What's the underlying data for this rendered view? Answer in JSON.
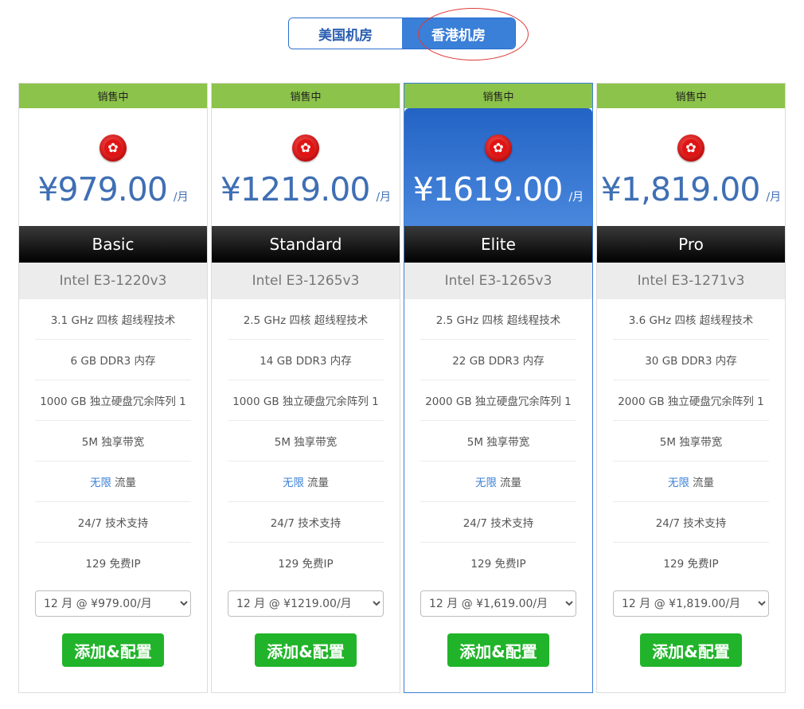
{
  "toggle": {
    "us": "美国机房",
    "hk": "香港机房"
  },
  "plans": [
    {
      "status": "销售中",
      "price": "¥979.00",
      "period": "/月",
      "name": "Basic",
      "cpu": "Intel E3-1220v3",
      "features": {
        "clock": "3.1 GHz 四核 超线程技术",
        "ram": "6 GB DDR3 内存",
        "disk": "1000 GB 独立硬盘冗余阵列 1",
        "bandwidth": "5M 独享带宽",
        "traffic_hl": "无限",
        "traffic": "流量",
        "support": "24/7 技术支持",
        "ip": "129 免费IP"
      },
      "cycle": "12 月 @ ¥979.00/月",
      "order": "添加&配置"
    },
    {
      "status": "销售中",
      "price": "¥1219.00",
      "period": "/月",
      "name": "Standard",
      "cpu": "Intel E3-1265v3",
      "features": {
        "clock": "2.5 GHz 四核 超线程技术",
        "ram": "14 GB DDR3 内存",
        "disk": "1000 GB 独立硬盘冗余阵列 1",
        "bandwidth": "5M 独享带宽",
        "traffic_hl": "无限",
        "traffic": "流量",
        "support": "24/7 技术支持",
        "ip": "129 免费IP"
      },
      "cycle": "12 月 @ ¥1219.00/月",
      "order": "添加&配置"
    },
    {
      "status": "销售中",
      "price": "¥1619.00",
      "period": "/月",
      "name": "Elite",
      "cpu": "Intel E3-1265v3",
      "features": {
        "clock": "2.5 GHz 四核 超线程技术",
        "ram": "22 GB DDR3 内存",
        "disk": "2000 GB 独立硬盘冗余阵列 1",
        "bandwidth": "5M 独享带宽",
        "traffic_hl": "无限",
        "traffic": "流量",
        "support": "24/7 技术支持",
        "ip": "129 免费IP"
      },
      "cycle": "12 月 @ ¥1,619.00/月",
      "order": "添加&配置"
    },
    {
      "status": "销售中",
      "price": "¥1,819.00",
      "period": "/月",
      "name": "Pro",
      "cpu": "Intel E3-1271v3",
      "features": {
        "clock": "3.6 GHz 四核 超线程技术",
        "ram": "30 GB DDR3 内存",
        "disk": "2000 GB 独立硬盘冗余阵列 1",
        "bandwidth": "5M 独享带宽",
        "traffic_hl": "无限",
        "traffic": "流量",
        "support": "24/7 技术支持",
        "ip": "129 免费IP"
      },
      "cycle": "12 月 @ ¥1,819.00/月",
      "order": "添加&配置"
    }
  ],
  "colors": {
    "status_bar": "#8cc34a",
    "accent_blue": "#3a7fd8",
    "order_green": "#21b42a",
    "annotation_red": "#e03a3a"
  }
}
